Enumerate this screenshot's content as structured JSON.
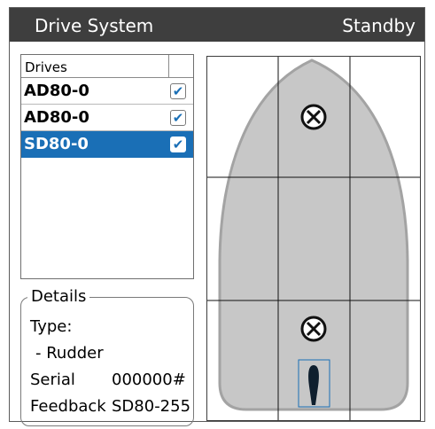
{
  "header": {
    "title": "Drive System",
    "status": "Standby"
  },
  "drives": {
    "column_header": "Drives",
    "items": [
      {
        "name": "AD80-0",
        "checked": "✔",
        "selected": false
      },
      {
        "name": "AD80-0",
        "checked": "✔",
        "selected": false
      },
      {
        "name": "SD80-0",
        "checked": "✔",
        "selected": true
      }
    ]
  },
  "details": {
    "legend": "Details",
    "type_label": "Type:",
    "type_value": "- Rudder",
    "serial_label": "Serial",
    "serial_value": "000000#",
    "feedback_label": "Feedback",
    "feedback_value": "SD80-255"
  },
  "colors": {
    "title_bar": "#3e3e3e",
    "selection": "#1a6fb6",
    "hull": "#c7c7c7",
    "rudder": "#0f1f2e"
  },
  "icons": [
    "drive-position-icon",
    "rudder-icon",
    "check-icon"
  ]
}
